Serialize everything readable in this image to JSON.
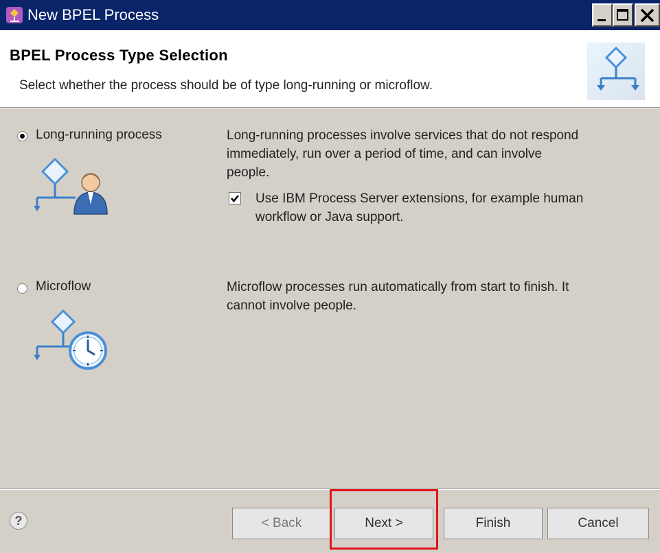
{
  "window": {
    "title": "New BPEL Process",
    "icons": {
      "app": "bpel-app-icon",
      "minimize": "minimize-icon",
      "maximize": "maximize-icon",
      "close": "close-icon"
    }
  },
  "header": {
    "title": "BPEL Process Type Selection",
    "description": "Select whether the process should be of type long-running or microflow.",
    "icon": "bpel-process-icon"
  },
  "options": [
    {
      "label": "Long-running process",
      "selected": true,
      "description": "Long-running processes involve services that do not respond immediately, run over a period of time, and can involve people.",
      "icon": "long-running-process-icon",
      "checkbox": {
        "checked": true,
        "label": "Use IBM Process Server extensions, for example human workflow or Java support."
      }
    },
    {
      "label": "Microflow",
      "selected": false,
      "description": "Microflow processes run automatically from start to finish. It cannot involve people.",
      "icon": "microflow-clock-icon"
    }
  ],
  "footer": {
    "help_icon": "help-icon",
    "help_glyph": "?",
    "back_label": "< Back",
    "next_label": "Next >",
    "finish_label": "Finish",
    "cancel_label": "Cancel"
  },
  "colors": {
    "titlebar": "#0a246a",
    "dialog_bg": "#d4d0c8",
    "highlight": "#e0141a",
    "icon_blue": "#4a90d9"
  }
}
